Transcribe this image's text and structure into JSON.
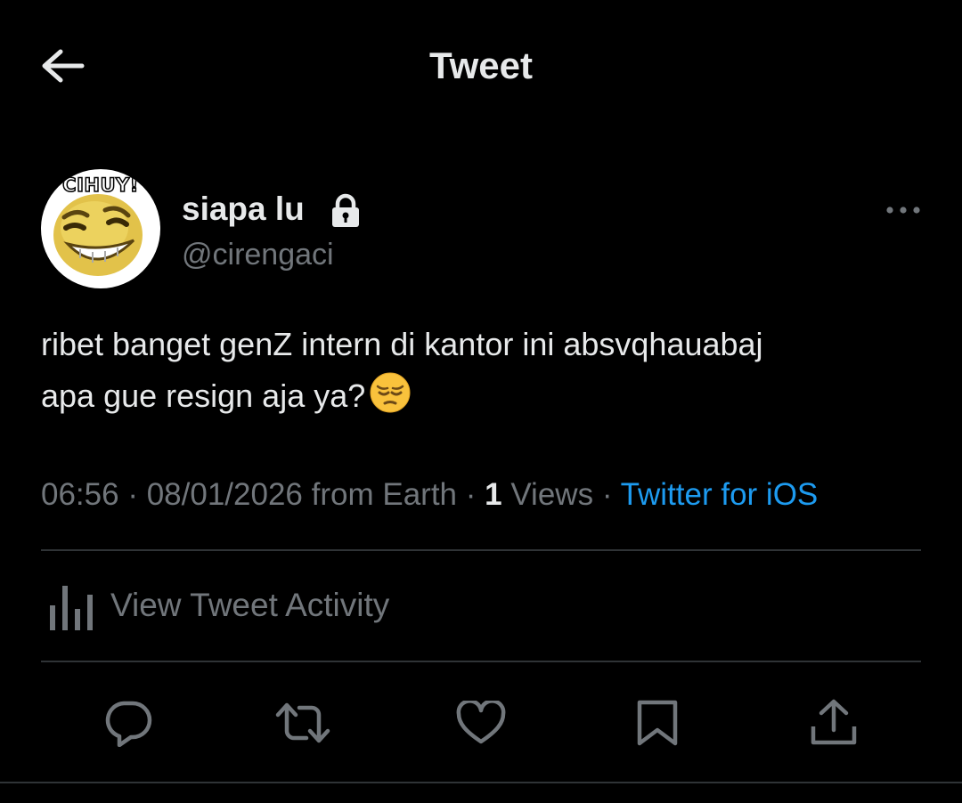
{
  "header": {
    "title": "Tweet",
    "back_icon": "arrow-left-icon"
  },
  "author": {
    "avatar_caption": "CIHUY!",
    "display_name": "siapa lu",
    "handle": "@cirengaci",
    "protected_icon": "lock-icon",
    "more_icon": "more-horizontal-icon"
  },
  "tweet": {
    "line1": "ribet banget genZ intern di kantor ini absvqhauabaj",
    "line2": "apa gue resign aja ya?",
    "emoji": "pensive-face"
  },
  "meta": {
    "time": "06:56",
    "date": "08/01/2026",
    "location": "from Earth",
    "separator": "·",
    "views_count": "1",
    "views_label": "Views",
    "source": "Twitter for iOS"
  },
  "activity": {
    "label": "View Tweet Activity",
    "icon": "analytics-bars-icon"
  },
  "actions": [
    {
      "icon": "reply-icon"
    },
    {
      "icon": "retweet-icon"
    },
    {
      "icon": "like-icon"
    },
    {
      "icon": "bookmark-icon"
    },
    {
      "icon": "share-icon"
    }
  ],
  "colors": {
    "background": "#000000",
    "text_primary": "#e7e9ea",
    "text_secondary": "#71767b",
    "accent": "#1d9bf0",
    "divider": "#2f3336"
  }
}
